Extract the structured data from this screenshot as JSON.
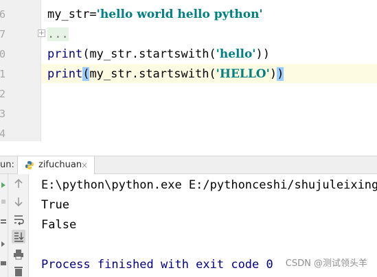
{
  "editor": {
    "line_numbers": [
      "6",
      "7",
      "0",
      "1",
      "2",
      "3",
      "4"
    ],
    "code": {
      "l1": {
        "ident": "my_str=",
        "str": "'hello world hello python'"
      },
      "l2": {
        "fold": "..."
      },
      "l3": {
        "fn": "print",
        "open": "(",
        "call": "my_str.startswith(",
        "str": "'hello'",
        "close": "))"
      },
      "l4": {
        "fn": "print",
        "open": "(",
        "call": "my_str.startswith(",
        "str": "'HELLO'",
        "close1": ")",
        "close2": ")"
      }
    },
    "fold_marker": "+"
  },
  "run_window": {
    "label": "un:",
    "tab": {
      "title": "zifuchuan",
      "close": "×"
    },
    "output": [
      "E:\\python\\python.exe E:/pythonceshi/shujuleixing/",
      "True",
      "False",
      "",
      "Process finished with exit code 0"
    ]
  },
  "watermark": "CSDN @测试领头羊",
  "colors": {
    "gutter_bg": "#f0f0f0",
    "string": "#008080",
    "builtin": "#000080",
    "caret_row": "#fdfbe1",
    "brace_match": "#99ccff"
  }
}
